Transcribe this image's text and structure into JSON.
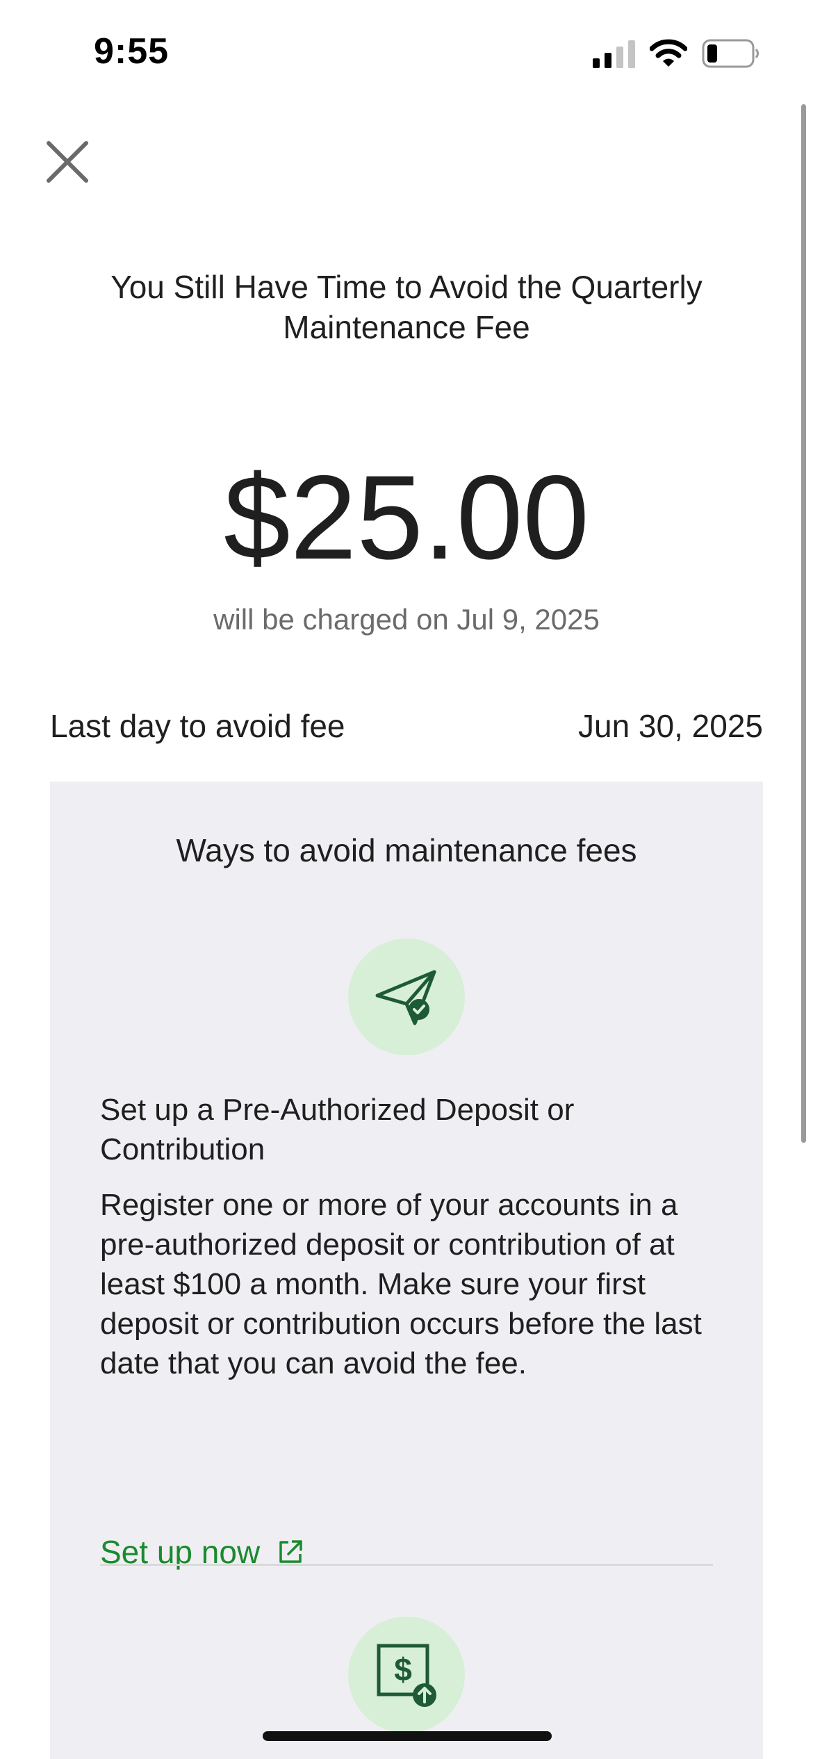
{
  "status_bar": {
    "time": "9:55",
    "icons": [
      "signal-icon",
      "wifi-icon",
      "battery-icon"
    ]
  },
  "header": {
    "close_icon": "close-icon",
    "title": "You Still Have Time to Avoid the Quarterly Maintenance Fee"
  },
  "fee": {
    "amount": "$25.00",
    "charge_note": "will be charged on Jul 9, 2025"
  },
  "deadline": {
    "label": "Last day to avoid fee",
    "date": "Jun 30, 2025"
  },
  "ways": {
    "title": "Ways to avoid maintenance fees",
    "options": [
      {
        "icon": "paper-plane-check-icon",
        "title": "Set up a Pre-Authorized Deposit or Contribution",
        "body": "Register one or more of your accounts in a pre-authorized deposit or contribution of at least $100 a month. Make sure your first deposit or contribution occurs before the last date that you can avoid the fee.",
        "link_label": "Set up now",
        "link_icon": "external-link-icon"
      },
      {
        "icon": "dollar-deposit-icon"
      }
    ]
  },
  "colors": {
    "accent_green": "#1a8a2e",
    "icon_green": "#1e5a36",
    "icon_circle_bg": "#d7eed7",
    "panel_bg": "#efeff3",
    "muted_text": "#6b6b6b"
  }
}
